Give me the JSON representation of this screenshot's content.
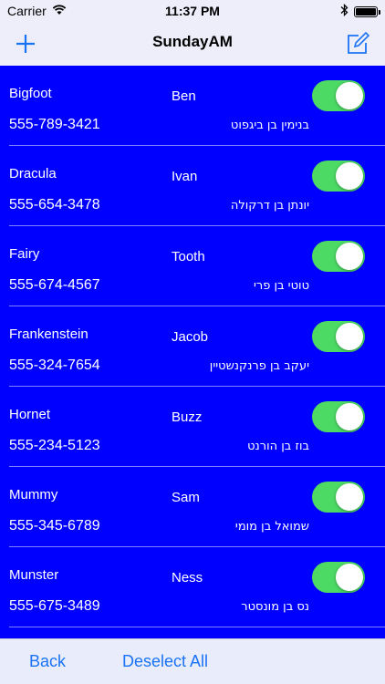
{
  "status_bar": {
    "carrier": "Carrier",
    "time": "11:37 PM"
  },
  "nav": {
    "title": "SundayAM",
    "add_icon": "plus-icon",
    "edit_icon": "compose-icon"
  },
  "colors": {
    "list_background": "#0000ff",
    "toggle_on": "#4cd964",
    "toolbar_text": "#1a73f5"
  },
  "rows": [
    {
      "last_name": "Bigfoot",
      "first_name": "Ben",
      "phone": "555-789-3421",
      "hebrew_name": "בנימין בן ביגפוט",
      "toggle_on": true
    },
    {
      "last_name": "Dracula",
      "first_name": "Ivan",
      "phone": "555-654-3478",
      "hebrew_name": "יונתן בן דרקולה",
      "toggle_on": true
    },
    {
      "last_name": "Fairy",
      "first_name": "Tooth",
      "phone": "555-674-4567",
      "hebrew_name": "טוטי בן פרי",
      "toggle_on": true
    },
    {
      "last_name": "Frankenstein",
      "first_name": "Jacob",
      "phone": "555-324-7654",
      "hebrew_name": "יעקב בן פרנקנשטיין",
      "toggle_on": true
    },
    {
      "last_name": "Hornet",
      "first_name": "Buzz",
      "phone": "555-234-5123",
      "hebrew_name": "בוז בן הורנט",
      "toggle_on": true
    },
    {
      "last_name": "Mummy",
      "first_name": "Sam",
      "phone": "555-345-6789",
      "hebrew_name": "שמואל בן מומי",
      "toggle_on": true
    },
    {
      "last_name": "Munster",
      "first_name": "Ness",
      "phone": "555-675-3489",
      "hebrew_name": "נס בן מונסטר",
      "toggle_on": true
    }
  ],
  "toolbar": {
    "back_label": "Back",
    "deselect_label": "Deselect All"
  }
}
